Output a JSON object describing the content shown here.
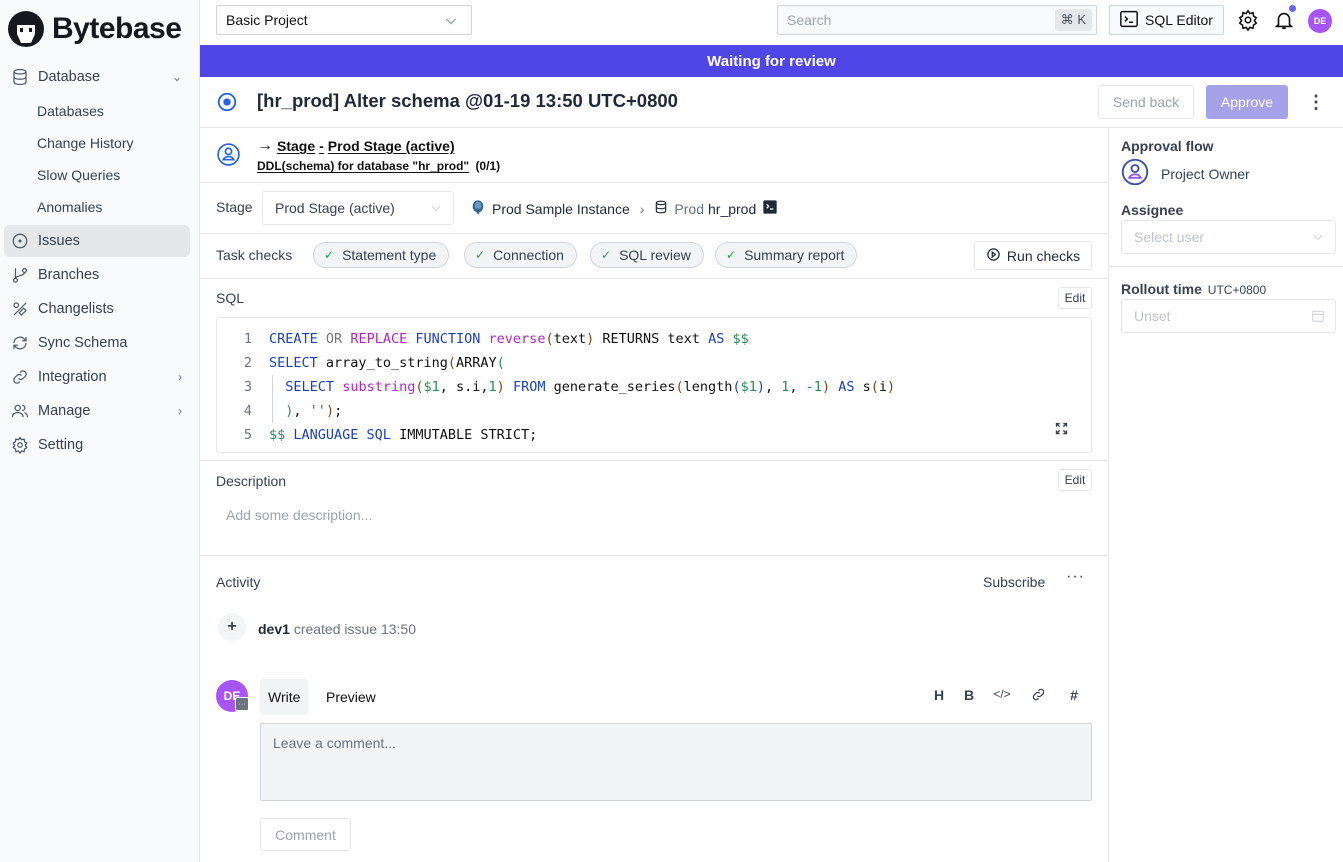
{
  "brand": {
    "name": "Bytebase"
  },
  "sidebar": {
    "items": [
      {
        "label": "Database",
        "icon": "database-icon",
        "expanded": true
      },
      {
        "label": "Issues",
        "icon": "issue-circle-icon",
        "active": true
      },
      {
        "label": "Branches",
        "icon": "branch-icon"
      },
      {
        "label": "Changelists",
        "icon": "changelist-icon"
      },
      {
        "label": "Sync Schema",
        "icon": "sync-icon"
      },
      {
        "label": "Integration",
        "icon": "link-icon",
        "has_children": true
      },
      {
        "label": "Manage",
        "icon": "users-icon",
        "has_children": true
      },
      {
        "label": "Setting",
        "icon": "gear-icon"
      }
    ],
    "database_sub": [
      "Databases",
      "Change History",
      "Slow Queries",
      "Anomalies"
    ]
  },
  "topbar": {
    "project": "Basic Project",
    "search_placeholder": "Search",
    "search_shortcut": "⌘ K",
    "sql_editor": "SQL Editor",
    "avatar_initials": "DE"
  },
  "banner": {
    "text": "Waiting for review",
    "color": "#4f46e5"
  },
  "issue": {
    "title": "[hr_prod] Alter schema @01-19 13:50 UTC+0800",
    "send_back": "Send back",
    "approve": "Approve"
  },
  "stage": {
    "arrow": "→",
    "stage_label": "Stage",
    "sep": "-",
    "stage_name": "Prod Stage (active)",
    "task_link": "DDL(schema) for database \"hr_prod\"",
    "task_count": "(0/1)",
    "row_label": "Stage",
    "selected": "Prod Stage (active)",
    "instance": "Prod Sample Instance",
    "env": "Prod",
    "database": "hr_prod"
  },
  "task_checks": {
    "label": "Task checks",
    "checks": [
      "Statement type",
      "Connection",
      "SQL review",
      "Summary report"
    ],
    "run_label": "Run checks"
  },
  "sql": {
    "label": "SQL",
    "edit": "Edit",
    "lines": [
      "CREATE OR REPLACE FUNCTION reverse(text) RETURNS text AS $$",
      "SELECT array_to_string(ARRAY(",
      "  SELECT substring($1, s.i,1) FROM generate_series(length($1), 1, -1) AS s(i)",
      "  ), '');",
      "$$ LANGUAGE SQL IMMUTABLE STRICT;"
    ]
  },
  "description": {
    "label": "Description",
    "edit": "Edit",
    "placeholder": "Add some description..."
  },
  "activity": {
    "label": "Activity",
    "subscribe": "Subscribe",
    "more": "···",
    "events": [
      {
        "user": "dev1",
        "action": "created issue 13:50"
      }
    ],
    "tabs": [
      "Write",
      "Preview"
    ],
    "format_tools": [
      "H",
      "B",
      "</>",
      "link",
      "#"
    ],
    "comment_placeholder": "Leave a comment...",
    "comment_button": "Comment",
    "avatar_initials": "DE"
  },
  "right_panel": {
    "approval_flow_label": "Approval flow",
    "approver": "Project Owner",
    "assignee_label": "Assignee",
    "assignee_placeholder": "Select user",
    "rollout_label": "Rollout time",
    "rollout_tz": "UTC+0800",
    "rollout_placeholder": "Unset"
  }
}
